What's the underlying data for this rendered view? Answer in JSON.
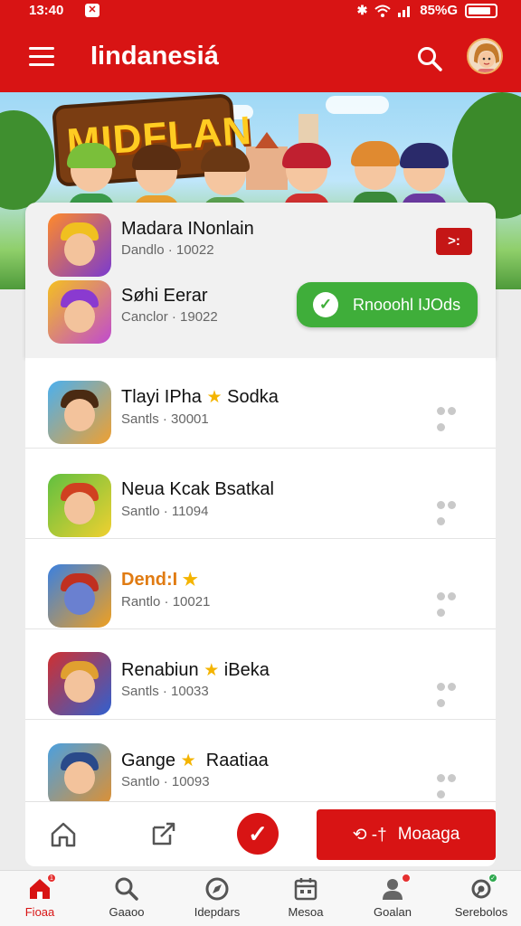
{
  "status_bar": {
    "time": "13:40",
    "battery": "85%G",
    "battery_level": 0.85,
    "signal_icon": "signal-icon",
    "wifi_icon": "wifi-icon",
    "bluetooth_icon": "bluetooth-icon"
  },
  "app_bar": {
    "title": "Iindanesiá",
    "menu_icon": "menu-icon",
    "search_icon": "search-icon"
  },
  "banner": {
    "logo_text": "MIDFLAN"
  },
  "featured": [
    {
      "title": "Madara INonlain",
      "subtitle": "Dandlo · 10022",
      "action_label": ">:"
    },
    {
      "title": "Søhi Eerar",
      "subtitle": "Canclor · 19022",
      "action_label": "Rnooohl IJOds"
    }
  ],
  "games": [
    {
      "title": "Tlayi IPha",
      "title_extra": "Sodka",
      "has_star": true,
      "subtitle": "Santls · 30001",
      "title_color": "#111111"
    },
    {
      "title": "Neua Kcak Bsatkal",
      "title_extra": "",
      "has_star": false,
      "subtitle": "Santlo · 11094",
      "title_color": "#111111"
    },
    {
      "title": "Dend:I",
      "title_extra": "",
      "has_star": true,
      "subtitle": "Rantlo · 10021",
      "title_color": "#e07b12"
    },
    {
      "title": "Renabiun",
      "title_extra": "iBeka",
      "has_star": true,
      "subtitle": "Santls · 10033",
      "title_color": "#111111"
    },
    {
      "title": "Gange",
      "title_extra": "Raatiaa",
      "has_star": true,
      "subtitle": "Santlo · 10093",
      "title_color": "#111111"
    }
  ],
  "action_bar": {
    "home_icon": "home-outline-icon",
    "share_icon": "share-icon",
    "check_icon": "check-icon",
    "primary_label": "Moaaga",
    "primary_prefix": "⟲ -†"
  },
  "bottom_nav": [
    {
      "label": "Fioaa",
      "icon": "home-icon",
      "active": true,
      "badge": "1"
    },
    {
      "label": "Gaaoo",
      "icon": "search-icon",
      "active": false,
      "badge": ""
    },
    {
      "label": "Idepdars",
      "icon": "compass-icon",
      "active": false,
      "badge": ""
    },
    {
      "label": "Mesoa",
      "icon": "calendar-icon",
      "active": false,
      "badge": ""
    },
    {
      "label": "Goalan",
      "icon": "profile-icon",
      "active": false,
      "badge": ""
    },
    {
      "label": "Serebolos",
      "icon": "settings-icon",
      "active": false,
      "badge": ""
    }
  ],
  "colors": {
    "brand_red": "#d81414",
    "accent_green": "#3fae3a",
    "star": "#f4b400"
  }
}
